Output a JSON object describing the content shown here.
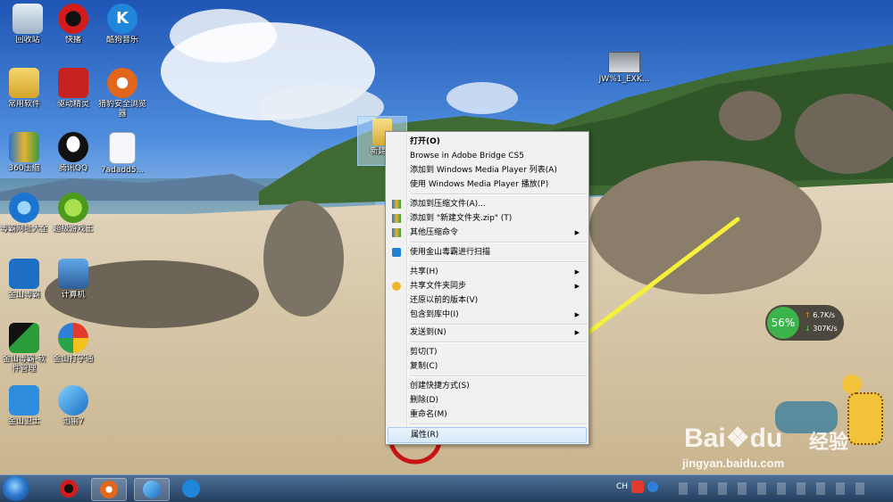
{
  "desktop_icons": [
    {
      "label": "回收站"
    },
    {
      "label": "快播"
    },
    {
      "label": "酷狗音乐"
    },
    {
      "label": "常用软件"
    },
    {
      "label": "驱动精灵"
    },
    {
      "label": "猎豹安全浏览器"
    },
    {
      "label": "360压缩"
    },
    {
      "label": "腾讯QQ"
    },
    {
      "label": "7adadd5..."
    },
    {
      "label": "毒霸网址大全"
    },
    {
      "label": "超级游戏王"
    },
    {
      "label": "金山毒霸"
    },
    {
      "label": "计算机"
    },
    {
      "label": "金山毒霸-软件管理"
    },
    {
      "label": "金山打字通"
    },
    {
      "label": "金山卫士"
    },
    {
      "label": "迅雷7"
    },
    {
      "label": "JW%1_EXK..."
    },
    {
      "label": "新建文"
    }
  ],
  "context_menu": {
    "items": [
      "打开(O)",
      "Browse in Adobe Bridge CS5",
      "添加到 Windows Media Player 列表(A)",
      "使用 Windows Media Player 播放(P)",
      "添加到压缩文件(A)...",
      "添加到 \"新建文件夹.zip\" (T)",
      "其他压缩命令",
      "使用金山毒霸进行扫描",
      "共享(H)",
      "共享文件夹同步",
      "还原以前的版本(V)",
      "包含到库中(I)",
      "发送到(N)",
      "剪切(T)",
      "复制(C)",
      "创建快捷方式(S)",
      "删除(D)",
      "重命名(M)",
      "属性(R)"
    ]
  },
  "net_widget": {
    "percent": "56%",
    "up": "6.7K/s",
    "down": "307K/s"
  },
  "watermark": {
    "brand": "Bai",
    "brand2": "du",
    "jingyan": "经验",
    "url": "jingyan.baidu.com"
  },
  "tray": {
    "lang": "CH"
  },
  "colors": {
    "annotation_arrow": "#f5f03a",
    "annotation_circle": "#c81414"
  }
}
